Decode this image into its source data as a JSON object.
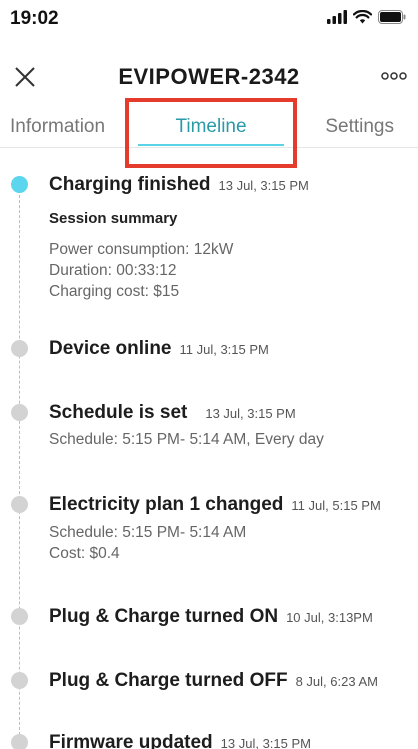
{
  "status_bar": {
    "time": "19:02",
    "icons": [
      "signal-icon",
      "wifi-icon",
      "battery-icon"
    ]
  },
  "header": {
    "title": "EVIPOWER-2342",
    "close_icon": "close-icon",
    "more_icon": "more-icon"
  },
  "tabs": [
    {
      "label": "Information",
      "active": false
    },
    {
      "label": "Timeline",
      "active": true
    },
    {
      "label": "Settings",
      "active": false
    }
  ],
  "colors": {
    "accent": "#5bd3e6",
    "active_tab_text": "#2a9aa8",
    "highlight_border": "#e53b2c",
    "inactive_dot": "#d3d3d3"
  },
  "timeline": {
    "events": [
      {
        "title": "Charging finished",
        "time": "13 Jul, 3:15 PM",
        "subtitle": "Session summary",
        "details": [
          "Power consumption: 12kW",
          "Duration: 00:33:12",
          "Charging cost: $15"
        ]
      },
      {
        "title": "Device online",
        "time": "11 Jul, 3:15 PM"
      },
      {
        "title": "Schedule is set",
        "time": "13 Jul, 3:15 PM",
        "details": [
          "Schedule: 5:15 PM- 5:14 AM, Every day"
        ]
      },
      {
        "title": "Electricity plan 1 changed",
        "time": "11 Jul, 5:15 PM",
        "details": [
          "Schedule: 5:15 PM- 5:14 AM",
          "Cost: $0.4"
        ]
      },
      {
        "title": "Plug & Charge turned ON",
        "time": "10 Jul, 3:13PM"
      },
      {
        "title": "Plug & Charge turned OFF",
        "time": "8 Jul, 6:23 AM"
      },
      {
        "title": "Firmware updated",
        "time": "13 Jul, 3:15 PM"
      }
    ]
  }
}
